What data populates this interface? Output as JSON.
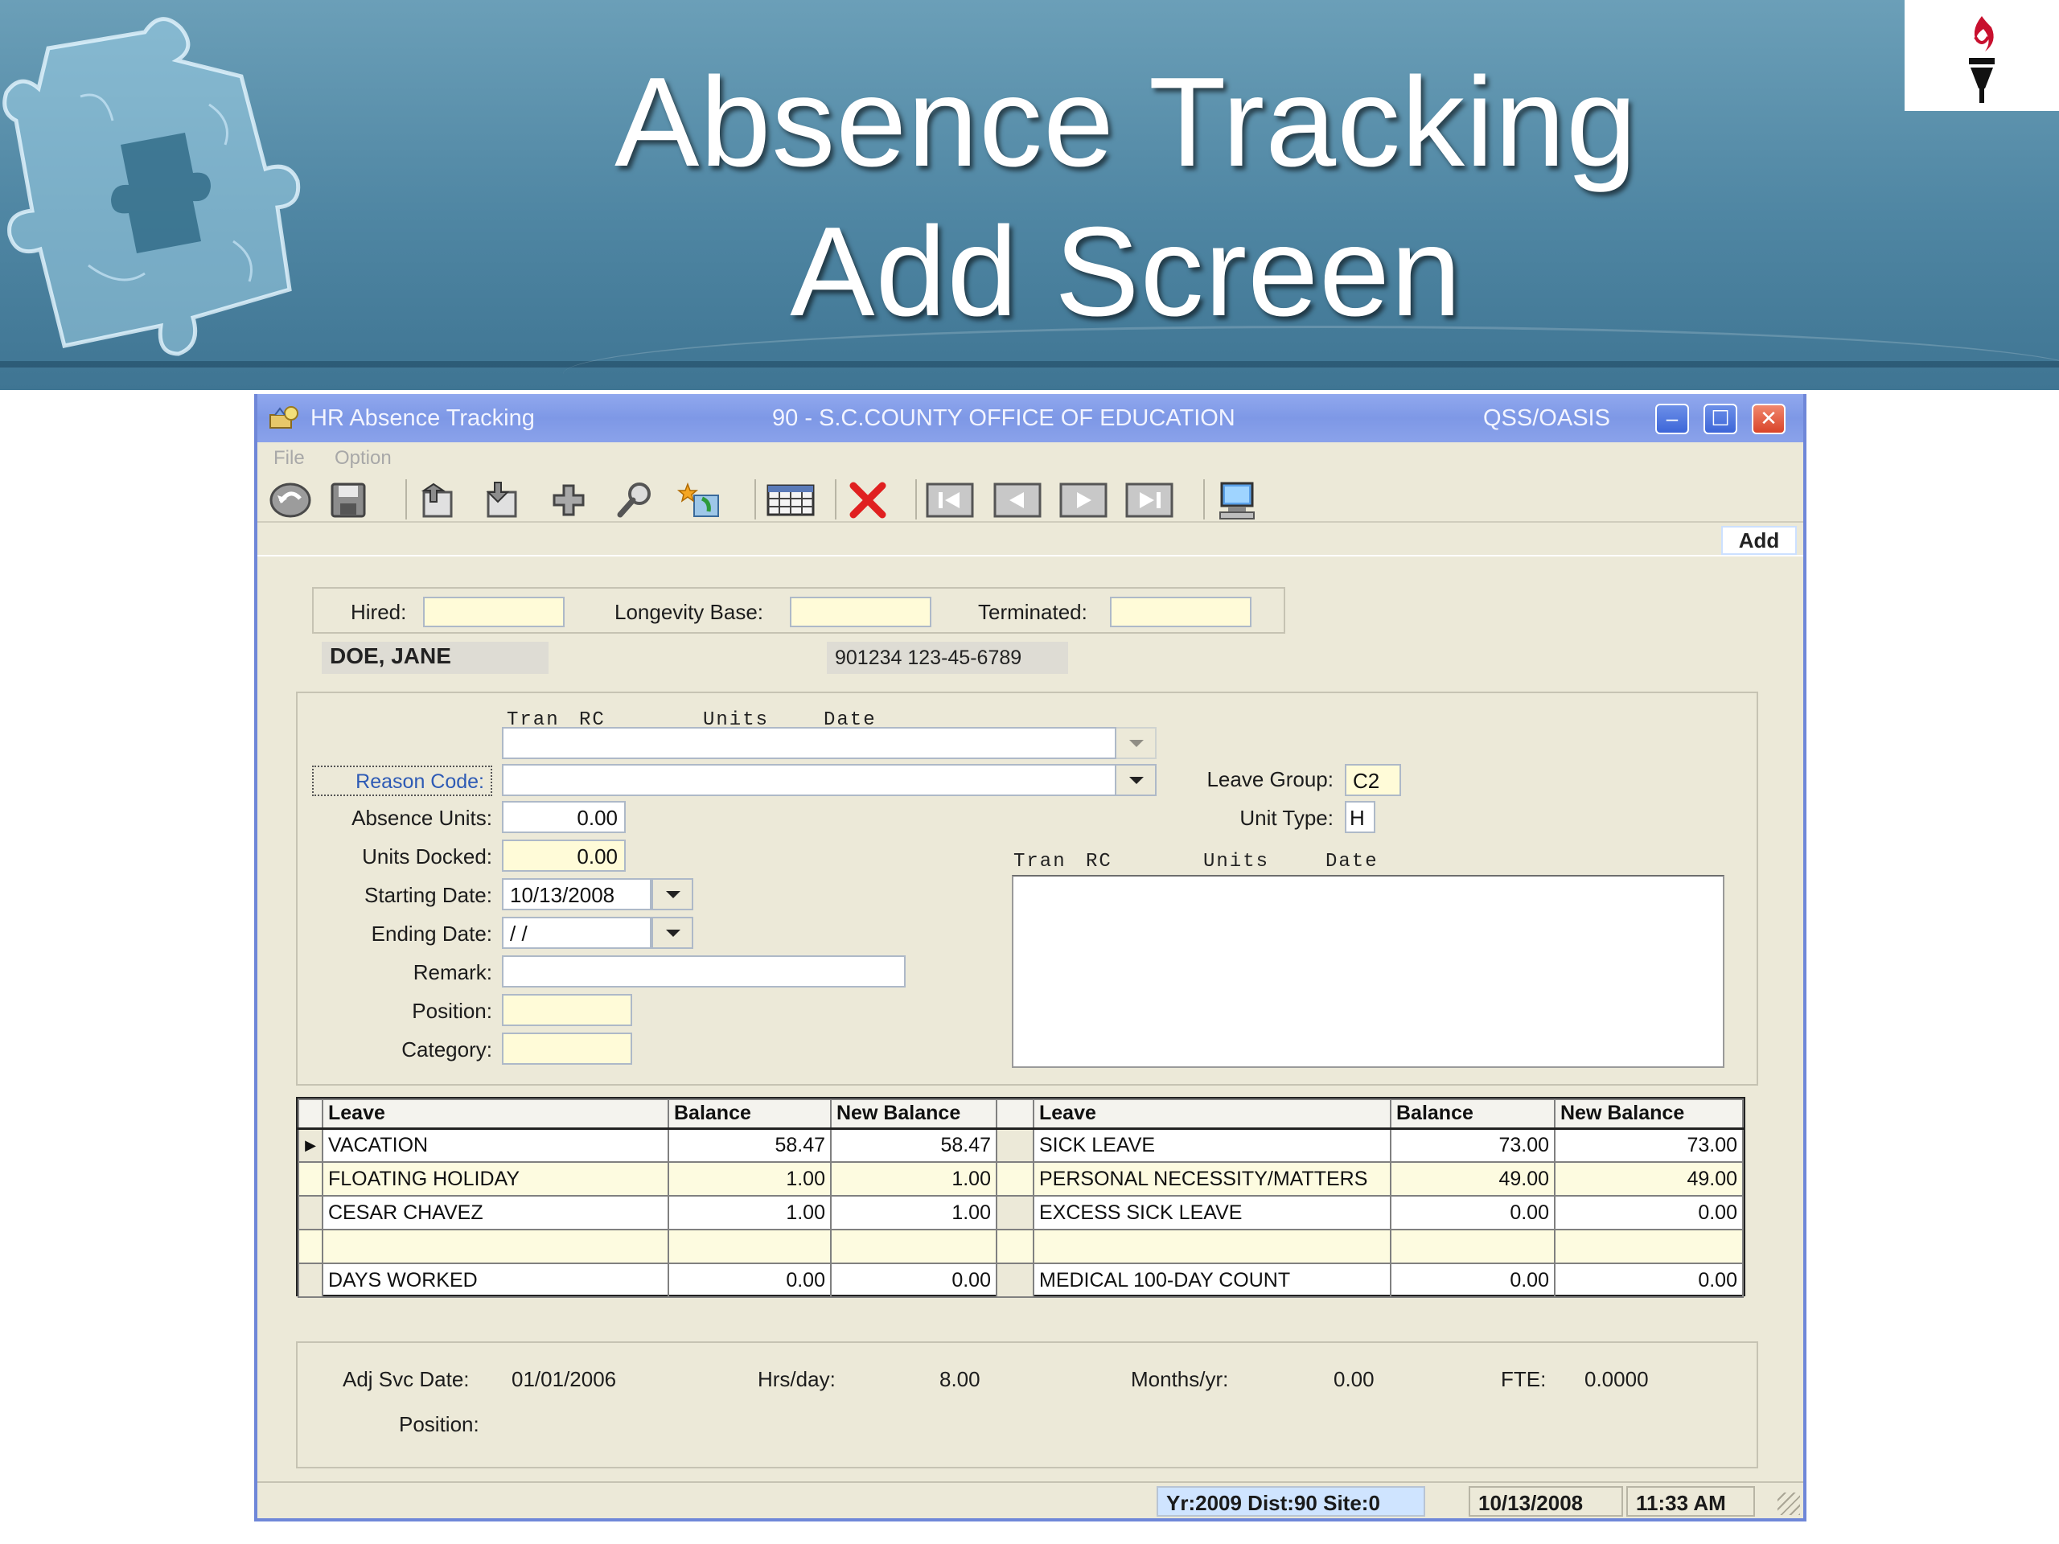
{
  "slide": {
    "title_line1": "Absence Tracking",
    "title_line2": "Add Screen"
  },
  "window": {
    "app_title": "HR Absence Tracking",
    "org_title": "90 - S.C.COUNTY OFFICE OF EDUCATION",
    "system_title": "QSS/OASIS",
    "controls": {
      "minimize": "–",
      "maximize": "☐",
      "close": "✕"
    }
  },
  "menu": {
    "file": "File",
    "option": "Option"
  },
  "toolbar": {
    "icons": [
      "exit-icon",
      "save-icon",
      "upload-icon",
      "download-icon",
      "add-icon",
      "search-icon",
      "wizard-icon",
      "grid-icon",
      "delete-icon",
      "first-record-icon",
      "previous-record-icon",
      "next-record-icon",
      "last-record-icon",
      "computer-icon"
    ]
  },
  "mode": "Add",
  "header": {
    "hired_label": "Hired:",
    "hired_value": "",
    "longevity_label": "Longevity Base:",
    "longevity_value": "",
    "terminated_label": "Terminated:",
    "terminated_value": "",
    "employee_name": "DOE, JANE",
    "employee_ids": "901234  123-45-6789"
  },
  "entry": {
    "col_tran": "Tran",
    "col_rc": "RC",
    "col_units": "Units",
    "col_date": "Date",
    "prior_select_value": "",
    "reason_code_label": "Reason Code:",
    "reason_code_value": "",
    "absence_units_label": "Absence Units:",
    "absence_units_value": "0.00",
    "units_docked_label": "Units Docked:",
    "units_docked_value": "0.00",
    "starting_date_label": "Starting Date:",
    "starting_date_value": "10/13/2008",
    "ending_date_label": "Ending Date:",
    "ending_date_value": " /  /",
    "remark_label": "Remark:",
    "remark_value": "",
    "position_label": "Position:",
    "position_value": "",
    "category_label": "Category:",
    "category_value": "",
    "leave_group_label": "Leave Group:",
    "leave_group_value": "C2",
    "unit_type_label": "Unit Type:",
    "unit_type_value": "H",
    "list_col_tran": "Tran",
    "list_col_rc": "RC",
    "list_col_units": "Units",
    "list_col_date": "Date"
  },
  "leave_grid": {
    "headers": {
      "leave": "Leave",
      "balance": "Balance",
      "new_balance": "New Balance"
    },
    "row_marker": "▶",
    "rows": [
      {
        "leave_l": "VACATION",
        "bal_l": "58.47",
        "new_l": "58.47",
        "leave_r": "SICK LEAVE",
        "bal_r": "73.00",
        "new_r": "73.00"
      },
      {
        "leave_l": "FLOATING HOLIDAY",
        "bal_l": "1.00",
        "new_l": "1.00",
        "leave_r": "PERSONAL NECESSITY/MATTERS",
        "bal_r": "49.00",
        "new_r": "49.00"
      },
      {
        "leave_l": "CESAR CHAVEZ",
        "bal_l": "1.00",
        "new_l": "1.00",
        "leave_r": "EXCESS SICK LEAVE",
        "bal_r": "0.00",
        "new_r": "0.00"
      },
      {
        "leave_l": "",
        "bal_l": "",
        "new_l": "",
        "leave_r": "",
        "bal_r": "",
        "new_r": ""
      },
      {
        "leave_l": "DAYS WORKED",
        "bal_l": "0.00",
        "new_l": "0.00",
        "leave_r": "MEDICAL 100-DAY COUNT",
        "bal_r": "0.00",
        "new_r": "0.00"
      }
    ]
  },
  "service": {
    "adj_svc_date_label": "Adj Svc Date:",
    "adj_svc_date_value": "01/01/2006",
    "hrs_day_label": "Hrs/day:",
    "hrs_day_value": "8.00",
    "months_yr_label": "Months/yr:",
    "months_yr_value": "0.00",
    "fte_label": "FTE:",
    "fte_value": "0.0000",
    "position_label": "Position:",
    "position_value": ""
  },
  "status": {
    "year_dist_site": "Yr:2009  Dist:90  Site:0",
    "date": "10/13/2008",
    "time": "11:33 AM"
  }
}
